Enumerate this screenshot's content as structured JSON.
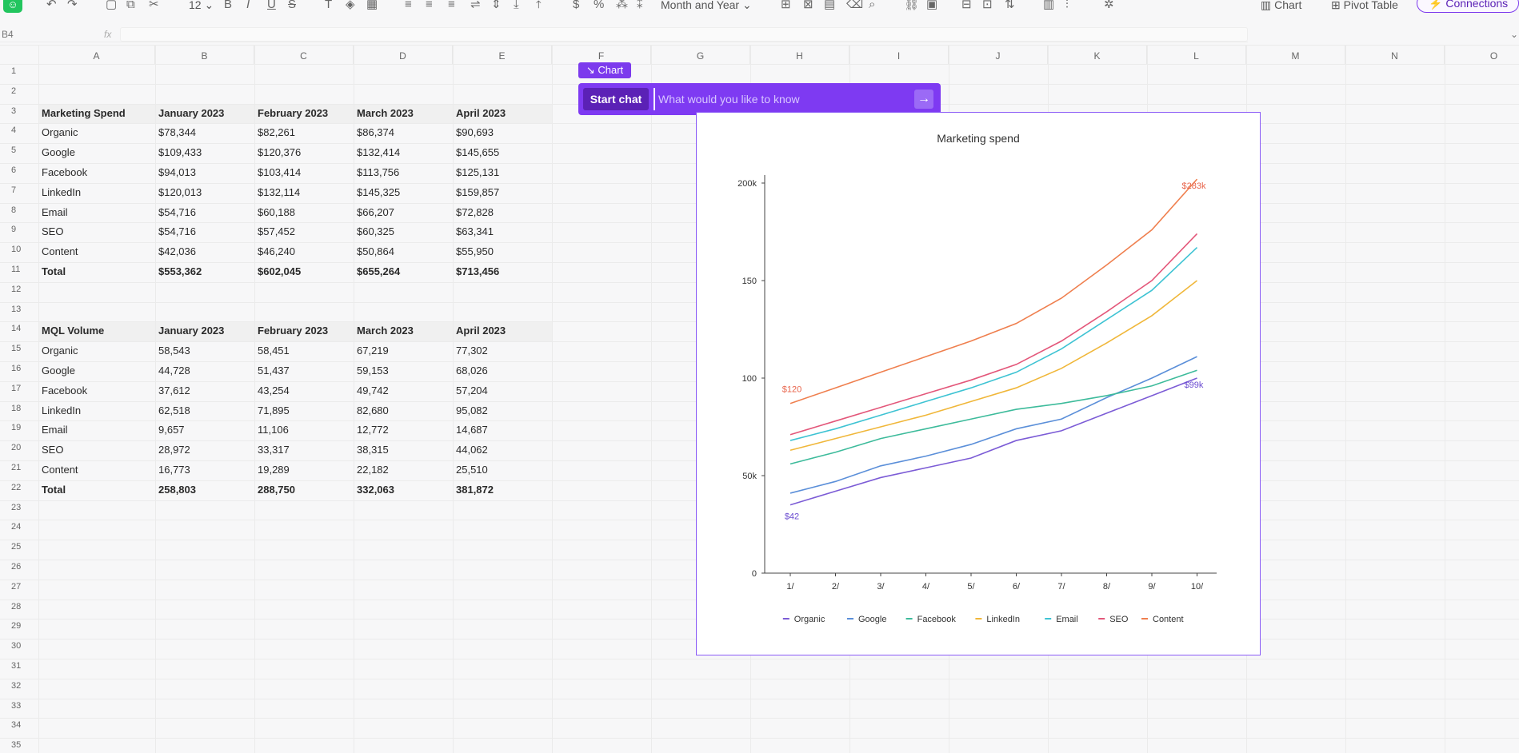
{
  "toolbar": {
    "font_size": "12",
    "date_format": "Month and Year",
    "chart_label": "Chart",
    "pivot_label": "Pivot Table",
    "connections_label": "Connections",
    "currency_symbol": "$",
    "percent_symbol": "%",
    "bold_glyph": "B",
    "italic_glyph": "I",
    "underline_glyph": "U",
    "strike_glyph": "S",
    "text_glyph": "T"
  },
  "formula_bar": {
    "cell_ref": "B4",
    "fx_label": "fx"
  },
  "columns": [
    "A",
    "B",
    "C",
    "D",
    "E",
    "F",
    "G",
    "H",
    "I",
    "J",
    "K",
    "L",
    "M",
    "N",
    "O"
  ],
  "rows": [
    "1",
    "2",
    "3",
    "4",
    "5",
    "6",
    "7",
    "8",
    "9",
    "10",
    "11",
    "12",
    "13",
    "14",
    "15",
    "16",
    "17",
    "18",
    "19",
    "20",
    "21",
    "22",
    "23",
    "24",
    "25",
    "26",
    "27",
    "28",
    "29",
    "30",
    "31",
    "32",
    "33",
    "34",
    "35"
  ],
  "table1": {
    "header": [
      "Marketing Spend",
      "January 2023",
      "February 2023",
      "March 2023",
      "April 2023"
    ],
    "rows": [
      [
        "Organic",
        "$78,344",
        "$82,261",
        "$86,374",
        "$90,693"
      ],
      [
        "Google",
        "$109,433",
        "$120,376",
        "$132,414",
        "$145,655"
      ],
      [
        "Facebook",
        "$94,013",
        "$103,414",
        "$113,756",
        "$125,131"
      ],
      [
        "LinkedIn",
        "$120,013",
        "$132,114",
        "$145,325",
        "$159,857"
      ],
      [
        "Email",
        "$54,716",
        "$60,188",
        "$66,207",
        "$72,828"
      ],
      [
        "SEO",
        "$54,716",
        "$57,452",
        "$60,325",
        "$63,341"
      ],
      [
        "Content",
        "$42,036",
        "$46,240",
        "$50,864",
        "$55,950"
      ]
    ],
    "total": [
      "Total",
      "$553,362",
      "$602,045",
      "$655,264",
      "$713,456"
    ]
  },
  "table2": {
    "header": [
      "MQL Volume",
      "January 2023",
      "February 2023",
      "March 2023",
      "April 2023"
    ],
    "rows": [
      [
        "Organic",
        "58,543",
        "58,451",
        "67,219",
        "77,302"
      ],
      [
        "Google",
        "44,728",
        "51,437",
        "59,153",
        "68,026"
      ],
      [
        "Facebook",
        "37,612",
        "43,254",
        "49,742",
        "57,204"
      ],
      [
        "LinkedIn",
        "62,518",
        "71,895",
        "82,680",
        "95,082"
      ],
      [
        "Email",
        "9,657",
        "11,106",
        "12,772",
        "14,687"
      ],
      [
        "SEO",
        "28,972",
        "33,317",
        "38,315",
        "44,062"
      ],
      [
        "Content",
        "16,773",
        "19,289",
        "22,182",
        "25,510"
      ]
    ],
    "total": [
      "Total",
      "258,803",
      "288,750",
      "332,063",
      "381,872"
    ]
  },
  "chat": {
    "tag_label": "↘ Chart",
    "button_label": "Start chat",
    "placeholder": "What would you like to know",
    "send_glyph": "→"
  },
  "chart_data": {
    "type": "line",
    "title": "Marketing spend",
    "x": [
      "1/",
      "2/",
      "3/",
      "4/",
      "5/",
      "6/",
      "7/",
      "8/",
      "9/",
      "10/"
    ],
    "ylim": [
      0,
      200000
    ],
    "yticks": [
      {
        "value": 0,
        "label": "0"
      },
      {
        "value": 50000,
        "label": "50k"
      },
      {
        "value": 100000,
        "label": "100"
      },
      {
        "value": 150000,
        "label": "150"
      },
      {
        "value": 200000,
        "label": "200k"
      }
    ],
    "series": [
      {
        "name": "Organic",
        "color": "#7c5cd6",
        "values": [
          35000,
          42000,
          49000,
          54000,
          59000,
          68000,
          73000,
          82000,
          91000,
          100000
        ]
      },
      {
        "name": "Google",
        "color": "#5b8fd9",
        "values": [
          41000,
          47000,
          55000,
          60000,
          66000,
          74000,
          79000,
          90000,
          100000,
          111000
        ]
      },
      {
        "name": "Facebook",
        "color": "#3dbb9b",
        "values": [
          56000,
          62000,
          69000,
          74000,
          79000,
          84000,
          87000,
          91000,
          96000,
          104000
        ]
      },
      {
        "name": "LinkedIn",
        "color": "#f0b73a",
        "values": [
          63000,
          69000,
          75000,
          81000,
          88000,
          95000,
          105000,
          118000,
          132000,
          150000
        ]
      },
      {
        "name": "Email",
        "color": "#3ec3d3",
        "values": [
          68000,
          74000,
          81000,
          88000,
          95000,
          103000,
          115000,
          130000,
          145000,
          167000
        ]
      },
      {
        "name": "SEO",
        "color": "#e3577a",
        "values": [
          71000,
          78000,
          85000,
          92000,
          99000,
          107000,
          119000,
          134000,
          150000,
          174000
        ]
      },
      {
        "name": "Content",
        "color": "#ef7f4e",
        "values": [
          87000,
          95000,
          103000,
          111000,
          119000,
          128000,
          141000,
          158000,
          176000,
          202000
        ]
      }
    ],
    "annotations": [
      {
        "text": "$120",
        "series": "Content",
        "index": 0,
        "color": "#e8634a"
      },
      {
        "text": "$283k",
        "series": "Content",
        "index": 9,
        "color": "#e8634a"
      },
      {
        "text": "$42",
        "series": "Organic",
        "index": 0,
        "color": "#6a4bd0"
      },
      {
        "text": "$99k",
        "series": "Organic",
        "index": 9,
        "color": "#6a4bd0"
      }
    ],
    "legend": "bottom",
    "grid": false
  }
}
